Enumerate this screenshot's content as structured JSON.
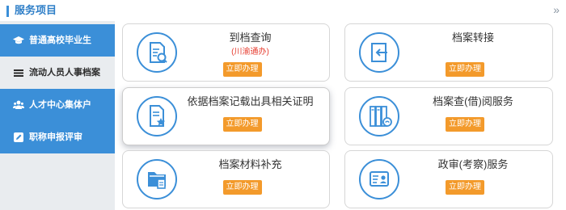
{
  "header": {
    "title": "服务项目",
    "toggle_icon": "double-chevron-right-icon",
    "accent_color": "#3b8fd8"
  },
  "sidebar": {
    "items": [
      {
        "label": "普通高校毕业生",
        "icon": "graduation-cap-icon",
        "active": false
      },
      {
        "label": "流动人员人事档案",
        "icon": "list-icon",
        "active": true
      },
      {
        "label": "人才中心集体户",
        "icon": "users-icon",
        "active": false
      },
      {
        "label": "职称申报评审",
        "icon": "edit-icon",
        "active": false
      }
    ]
  },
  "services": [
    {
      "title": "到档查询",
      "subtitle": "(川渝通办)",
      "button": "立即办理",
      "icon": "document-search-icon"
    },
    {
      "title": "档案转接",
      "subtitle": "",
      "button": "立即办理",
      "icon": "transfer-icon"
    },
    {
      "title": "依据档案记载出具相关证明",
      "subtitle": "",
      "button": "立即办理",
      "icon": "certificate-icon"
    },
    {
      "title": "档案查(借)阅服务",
      "subtitle": "",
      "button": "立即办理",
      "icon": "archive-binders-icon"
    },
    {
      "title": "档案材料补充",
      "subtitle": "",
      "button": "立即办理",
      "icon": "folder-add-icon"
    },
    {
      "title": "政审(考察)服务",
      "subtitle": "",
      "button": "立即办理",
      "icon": "id-card-icon"
    }
  ],
  "colors": {
    "sidebar_active_bg": "#e9ecef",
    "sidebar_bg": "#3b8fd8",
    "button_bg": "#f39a2b",
    "subtitle_color": "#e63b2e"
  }
}
